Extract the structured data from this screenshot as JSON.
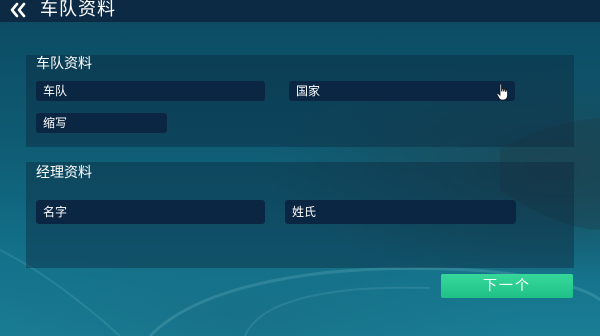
{
  "header": {
    "back_icon": "double-chevron-left-icon",
    "title": "车队资料"
  },
  "team_section": {
    "label": "车队资料",
    "fields": {
      "team": "车队",
      "country": "国家",
      "abbreviation": "缩写"
    }
  },
  "manager_section": {
    "label": "经理资料",
    "fields": {
      "first_name": "名字",
      "last_name": "姓氏"
    }
  },
  "footer": {
    "next_label": "下一个"
  },
  "colors": {
    "accent_button": "#2ccf92",
    "field_bg": "#0b2643",
    "header_bg": "#0d2a44"
  },
  "cursor": "hand-pointer-icon"
}
